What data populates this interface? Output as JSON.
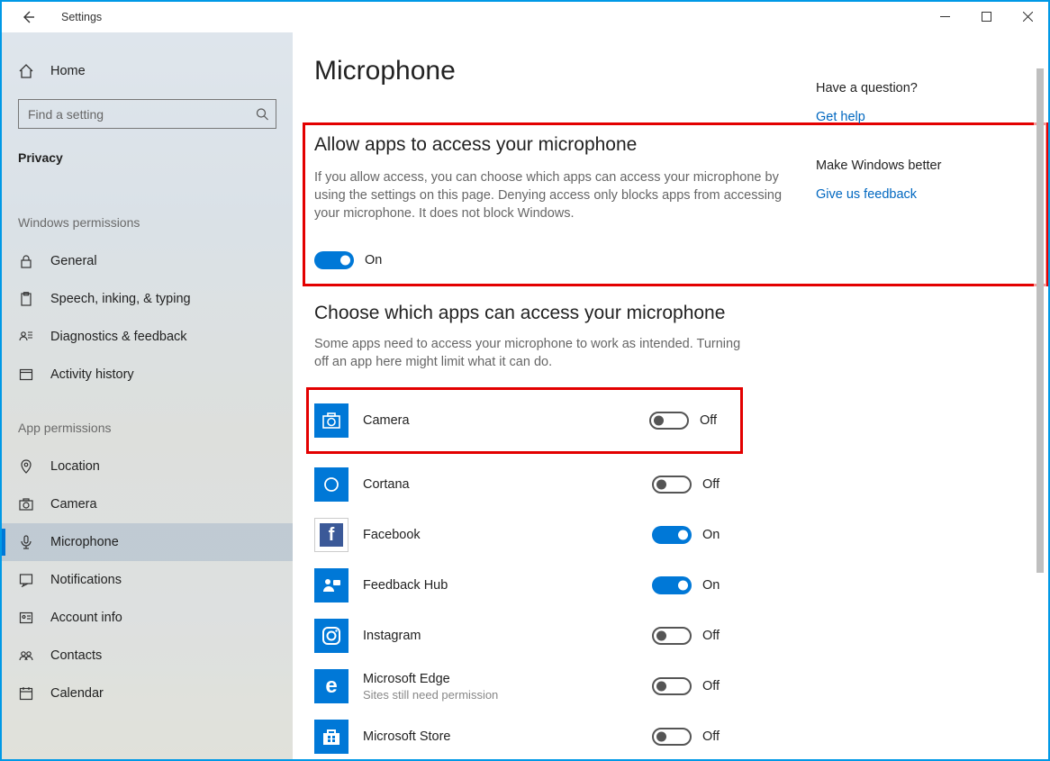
{
  "window": {
    "title": "Settings"
  },
  "sidebar": {
    "home": "Home",
    "search_placeholder": "Find a setting",
    "category": "Privacy",
    "group1": "Windows permissions",
    "items1": [
      {
        "label": "General"
      },
      {
        "label": "Speech, inking, & typing"
      },
      {
        "label": "Diagnostics & feedback"
      },
      {
        "label": "Activity history"
      }
    ],
    "group2": "App permissions",
    "items2": [
      {
        "label": "Location"
      },
      {
        "label": "Camera"
      },
      {
        "label": "Microphone",
        "selected": true
      },
      {
        "label": "Notifications"
      },
      {
        "label": "Account info"
      },
      {
        "label": "Contacts"
      },
      {
        "label": "Calendar"
      }
    ]
  },
  "page": {
    "title": "Microphone",
    "allow_section_title": "Allow apps to access your microphone",
    "allow_section_desc": "If you allow access, you can choose which apps can access your microphone by using the settings on this page. Denying access only blocks apps from accessing your microphone. It does not block Windows.",
    "allow_toggle": {
      "state": "On",
      "on": true
    },
    "choose_title": "Choose which apps can access your microphone",
    "choose_desc": "Some apps need to access your microphone to work as intended. Turning off an app here might limit what it can do.",
    "apps": [
      {
        "name": "Camera",
        "state": "Off",
        "on": false,
        "highlight": true
      },
      {
        "name": "Cortana",
        "state": "Off",
        "on": false
      },
      {
        "name": "Facebook",
        "state": "On",
        "on": true
      },
      {
        "name": "Feedback Hub",
        "state": "On",
        "on": true
      },
      {
        "name": "Instagram",
        "state": "Off",
        "on": false
      },
      {
        "name": "Microsoft Edge",
        "sub": "Sites still need permission",
        "state": "Off",
        "on": false
      },
      {
        "name": "Microsoft Store",
        "state": "Off",
        "on": false
      }
    ]
  },
  "rail": {
    "q_title": "Have a question?",
    "q_link": "Get help",
    "fb_title": "Make Windows better",
    "fb_link": "Give us feedback"
  }
}
